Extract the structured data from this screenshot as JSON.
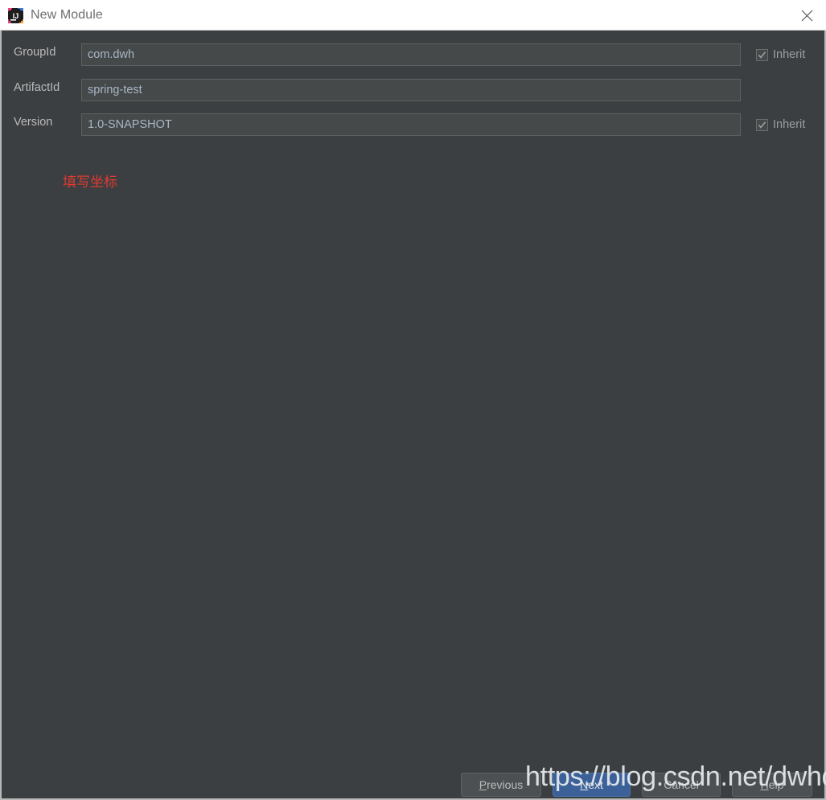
{
  "window": {
    "title": "New Module",
    "app_icon": "intellij-idea-icon",
    "close_icon": "close-icon",
    "background_color": "#3c3f41",
    "titlebar_color": "#ffffff"
  },
  "form": {
    "rows": [
      {
        "label": "GroupId",
        "value": "com.dwh",
        "placeholder": "",
        "has_inherit": true,
        "inherit_label": "Inherit",
        "inherit_checked": true
      },
      {
        "label": "ArtifactId",
        "value": "spring-test",
        "placeholder": "",
        "has_inherit": false,
        "inherit_label": "",
        "inherit_checked": false
      },
      {
        "label": "Version",
        "value": "1.0-SNAPSHOT",
        "placeholder": "",
        "has_inherit": true,
        "inherit_label": "Inherit",
        "inherit_checked": true
      }
    ]
  },
  "annotation": {
    "text": "填写坐标",
    "color": "#e03a32"
  },
  "buttons": {
    "previous": {
      "mnemonic": "P",
      "rest": "revious"
    },
    "next": {
      "mnemonic": "N",
      "rest": "ext",
      "accent_color": "#3c6199"
    },
    "cancel": {
      "label": "Cancel"
    },
    "help": {
      "mnemonic": "H",
      "rest": "elp"
    }
  },
  "watermark": {
    "text": "https://blog.csdn.net/dwhdome"
  }
}
